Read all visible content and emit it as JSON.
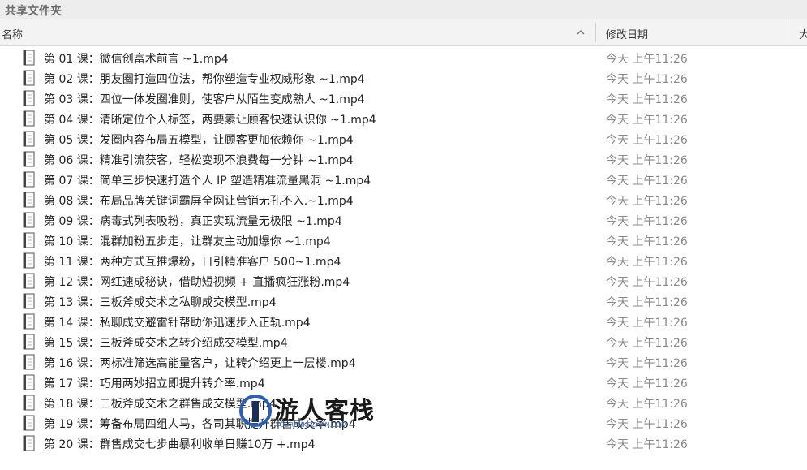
{
  "window": {
    "title": "共享文件夹"
  },
  "header": {
    "name": "名称",
    "date_modified": "修改日期",
    "size": "大"
  },
  "files": [
    {
      "name": "第 01 课：微信创富术前言 ~1.mp4",
      "date": "今天 上午11:26"
    },
    {
      "name": "第 02 课：朋友圈打造四位法，帮你塑造专业权威形象 ~1.mp4",
      "date": "今天 上午11:26"
    },
    {
      "name": "第 03 课：四位一体发圈准则，使客户从陌生变成熟人 ~1.mp4",
      "date": "今天 上午11:26"
    },
    {
      "name": "第 04 课：清晰定位个人标签，两要素让顾客快速认识你 ~1.mp4",
      "date": "今天 上午11:26"
    },
    {
      "name": "第 05 课：发圈内容布局五模型，让顾客更加依赖你 ~1.mp4",
      "date": "今天 上午11:26"
    },
    {
      "name": "第 06 课：精准引流获客，轻松变现不浪费每一分钟 ~1.mp4",
      "date": "今天 上午11:26"
    },
    {
      "name": "第 07 课：简单三步快速打造个人 IP 塑造精准流量黑洞 ~1.mp4",
      "date": "今天 上午11:26"
    },
    {
      "name": "第 08 课：布局品牌关键词霸屏全网让营销无孔不入.~1.mp4",
      "date": "今天 上午11:26"
    },
    {
      "name": "第 09 课：病毒式列表吸粉，真正实现流量无极限 ~1.mp4",
      "date": "今天 上午11:26"
    },
    {
      "name": "第 10 课：混群加粉五步走，让群友主动加爆你 ~1.mp4",
      "date": "今天 上午11:26"
    },
    {
      "name": "第 11 课：两种方式互推爆粉，日引精准客户 500~1.mp4",
      "date": "今天 上午11:26"
    },
    {
      "name": "第 12 课：网红速成秘诀，借助短视频 + 直播疯狂涨粉.mp4",
      "date": "今天 上午11:26"
    },
    {
      "name": "第 13 课：三板斧成交术之私聊成交模型.mp4",
      "date": "今天 上午11:26"
    },
    {
      "name": "第 14 课：私聊成交避雷针帮助你迅速步入正轨.mp4",
      "date": "今天 上午11:26"
    },
    {
      "name": "第 15 课：三板斧成交术之转介绍成交模型.mp4",
      "date": "今天 上午11:26"
    },
    {
      "name": "第 16 课：两标准筛选高能量客户，让转介绍更上一层楼.mp4",
      "date": "今天 上午11:26"
    },
    {
      "name": "第 17 课：巧用两妙招立即提升转介率.mp4",
      "date": "今天 上午11:26"
    },
    {
      "name": "第 18 课：三板斧成交术之群售成交模型.mp4",
      "date": "今天 上午11:26"
    },
    {
      "name": "第 19 课：筹备布局四组人马，各司其职提升群售成交率.mp4",
      "date": "今天 上午11:26"
    },
    {
      "name": "第 20 课：群售成交七步曲暴利收单日赚10万 +.mp4",
      "date": "今天 上午11:26"
    }
  ],
  "watermark": {
    "text": "游人客栈",
    "sub": "YOURENKEZHAN.COM"
  },
  "icons": {
    "file": "video-file-icon",
    "sort": "chevron-up-icon"
  },
  "colors": {
    "header_bg": "#f3f3f3",
    "titlebar_bg": "#ededed",
    "date_text": "#8a8a8a"
  }
}
